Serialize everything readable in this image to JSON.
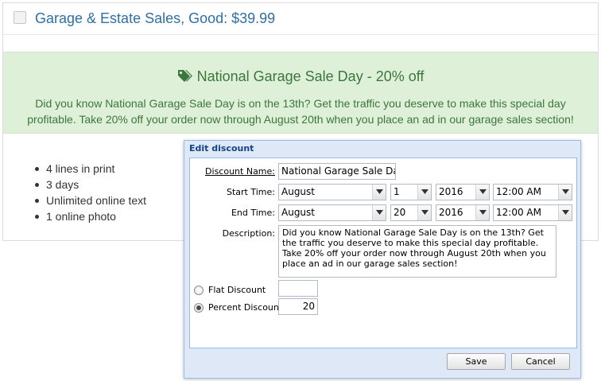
{
  "product": {
    "title": "Garage & Estate Sales, Good: $39.99",
    "checked": false
  },
  "promo": {
    "icon": "tags-icon",
    "title": "National Garage Sale Day - 20% off",
    "text": "Did you know National Garage Sale Day is on the 13th? Get the traffic you deserve to make this special day profitable. Take 20% off your order now through August 20th when you place an ad in our garage sales section!"
  },
  "features": [
    "4 lines in print",
    "3 days",
    "Unlimited online text",
    "1 online photo"
  ],
  "dialog": {
    "title": "Edit discount",
    "discount_name_label": "Discount Name:",
    "discount_name_value": "National Garage Sale Day",
    "start_time_label": "Start Time:",
    "start": {
      "month": "August",
      "day": "1",
      "year": "2016",
      "time": "12:00 AM"
    },
    "end_time_label": "End Time:",
    "end": {
      "month": "August",
      "day": "20",
      "year": "2016",
      "time": "12:00 AM"
    },
    "description_label": "Description:",
    "description_value": "Did you know National Garage Sale Day is on the 13th?  Get the traffic you deserve to make this special day profitable. Take 20% off your order now through August 20th when you place an ad in our garage sales section!",
    "flat_discount_label": "Flat Discount",
    "flat_discount_value": "",
    "percent_discount_label": "Percent Discount",
    "percent_discount_value": "20",
    "selected_discount_type": "percent",
    "save_label": "Save",
    "cancel_label": "Cancel"
  },
  "colors": {
    "title_blue": "#2f6fa3",
    "promo_bg": "#def0d8",
    "promo_text": "#3c763d",
    "dialog_header": "#15428b"
  }
}
